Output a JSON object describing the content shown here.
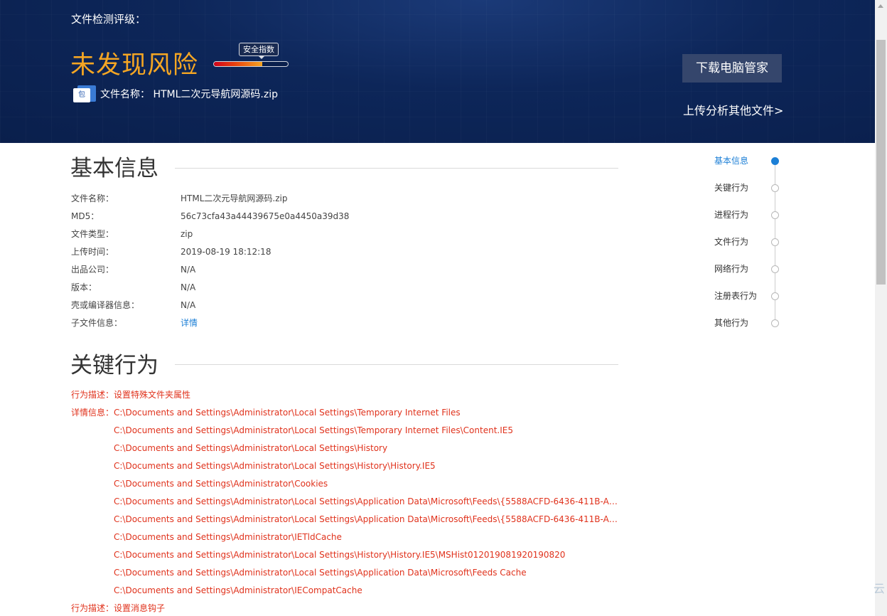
{
  "banner": {
    "rating_label": "文件检测评级：",
    "risk_title": "未发现风险",
    "index_tag": "安全指数",
    "index_level_percent": 65,
    "file_icon_char": "包",
    "file_name_label": "文件名称：",
    "file_name": "HTML二次元导航网源码.zip",
    "download_button": "下载电脑管家",
    "upload_link": "上传分析其他文件>"
  },
  "basic_info": {
    "title": "基本信息",
    "rows": [
      {
        "label": "文件名称：",
        "value": "HTML二次元导航网源码.zip"
      },
      {
        "label": "MD5：",
        "value": "56c73cfa43a44439675e0a4450a39d38"
      },
      {
        "label": "文件类型：",
        "value": "zip"
      },
      {
        "label": "上传时间：",
        "value": "2019-08-19 18:12:18"
      },
      {
        "label": "出品公司：",
        "value": "N/A"
      },
      {
        "label": "版本：",
        "value": "N/A"
      },
      {
        "label": "壳或编译器信息：",
        "value": "N/A"
      }
    ],
    "sub_file_label": "子文件信息：",
    "sub_file_link": "详情"
  },
  "key_behavior": {
    "title": "关键行为",
    "desc1": "行为描述：设置特殊文件夹属性",
    "detail_label": "详情信息：",
    "paths": [
      "C:\\Documents and Settings\\Administrator\\Local Settings\\Temporary Internet Files",
      "C:\\Documents and Settings\\Administrator\\Local Settings\\Temporary Internet Files\\Content.IE5",
      "C:\\Documents and Settings\\Administrator\\Local Settings\\History",
      "C:\\Documents and Settings\\Administrator\\Local Settings\\History\\History.IE5",
      "C:\\Documents and Settings\\Administrator\\Cookies",
      "C:\\Documents and Settings\\Administrator\\Local Settings\\Application Data\\Microsoft\\Feeds\\{5588ACFD-6436-411B-A5CE-...",
      "C:\\Documents and Settings\\Administrator\\Local Settings\\Application Data\\Microsoft\\Feeds\\{5588ACFD-6436-411B-A5CE-...",
      "C:\\Documents and Settings\\Administrator\\IETldCache",
      "C:\\Documents and Settings\\Administrator\\Local Settings\\History\\History.IE5\\MSHist012019081920190820",
      "C:\\Documents and Settings\\Administrator\\Local Settings\\Application Data\\Microsoft\\Feeds Cache",
      "C:\\Documents and Settings\\Administrator\\IECompatCache"
    ],
    "desc2": "行为描述：设置消息钩子"
  },
  "side_nav": {
    "items": [
      {
        "label": "基本信息",
        "active": true
      },
      {
        "label": "关键行为",
        "active": false
      },
      {
        "label": "进程行为",
        "active": false
      },
      {
        "label": "文件行为",
        "active": false
      },
      {
        "label": "网络行为",
        "active": false
      },
      {
        "label": "注册表行为",
        "active": false
      },
      {
        "label": "其他行为",
        "active": false
      }
    ]
  },
  "corner_char": "云",
  "colors": {
    "banner_bg": "#0d2659",
    "risk_title": "#f5a623",
    "link_blue": "#1c7fd6",
    "behavior_red": "#e0321c"
  }
}
